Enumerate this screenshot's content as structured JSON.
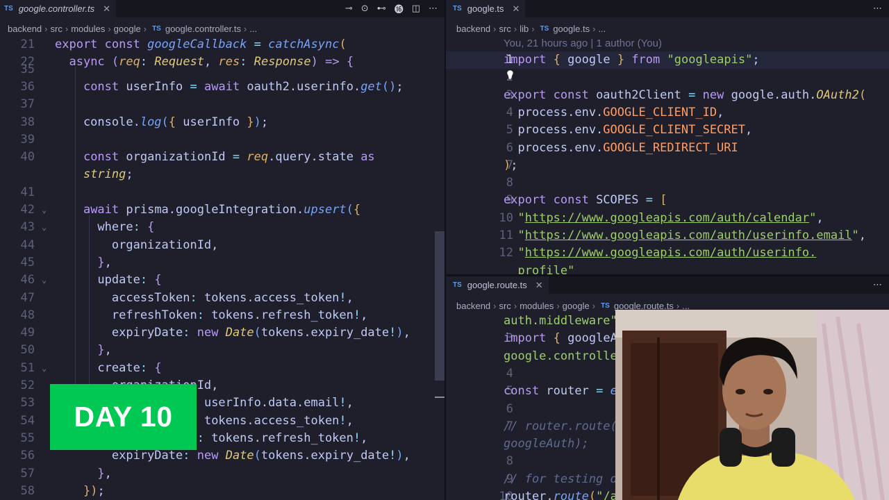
{
  "left_editor": {
    "tab": {
      "icon": "ts-file-icon",
      "label": "google.controller.ts"
    },
    "breadcrumbs": [
      "backend",
      "src",
      "modules",
      "google",
      "google.controller.ts",
      "..."
    ],
    "lines": [
      {
        "n": "21",
        "html": "<span class=\"k\">export const</span> <span class=\"f\">googleCallback</span> <span class=\"o\">=</span> <span class=\"f\">catchAsync</span><span class=\"b1\">(</span>"
      },
      {
        "n": "22",
        "html": "  <span class=\"k\">async</span> <span class=\"b2\">(</span><span class=\"p\">req</span><span class=\"o\">:</span> <span class=\"t\">Request</span>, <span class=\"p\">res</span><span class=\"o\">:</span> <span class=\"t\">Response</span><span class=\"b2\">)</span> <span class=\"k\">=&gt;</span> <span class=\"b2\">{</span>"
      },
      {
        "n": "35",
        "html": ""
      },
      {
        "n": "36",
        "html": "    <span class=\"k\">const</span> userInfo <span class=\"o\">=</span> <span class=\"k\">await</span> oauth2.userinfo.<span class=\"f\">get</span><span class=\"b3\">()</span>;"
      },
      {
        "n": "37",
        "html": ""
      },
      {
        "n": "38",
        "html": "    console.<span class=\"f\">log</span><span class=\"b3\">(</span><span class=\"b1\">{</span> userInfo <span class=\"b1\">}</span><span class=\"b3\">)</span>;"
      },
      {
        "n": "39",
        "html": ""
      },
      {
        "n": "40",
        "html": "    <span class=\"k\">const</span> organizationId <span class=\"o\">=</span> <span class=\"p\">req</span>.query.state <span class=\"k\">as</span>"
      },
      {
        "n": "",
        "html": "    <span class=\"t\">string</span>;"
      },
      {
        "n": "41",
        "html": ""
      },
      {
        "n": "42",
        "html": "    <span class=\"k\">await</span> prisma.googleIntegration.<span class=\"f\">upsert</span><span class=\"b3\">(</span><span class=\"b1\">{</span>"
      },
      {
        "n": "43",
        "html": "      where<span class=\"o\">:</span> <span class=\"b2\">{</span>"
      },
      {
        "n": "44",
        "html": "        organizationId,"
      },
      {
        "n": "45",
        "html": "      <span class=\"b2\">}</span>,"
      },
      {
        "n": "46",
        "html": "      update<span class=\"o\">:</span> <span class=\"b2\">{</span>"
      },
      {
        "n": "47",
        "html": "        accessToken<span class=\"o\">:</span> tokens.access_token<span class=\"o\">!</span>,"
      },
      {
        "n": "48",
        "html": "        refreshToken<span class=\"o\">:</span> tokens.refresh_token<span class=\"o\">!</span>,"
      },
      {
        "n": "49",
        "html": "        expiryDate<span class=\"o\">:</span> <span class=\"k\">new</span> <span class=\"t\">Date</span><span class=\"b3\">(</span>tokens.expiry_date<span class=\"o\">!</span><span class=\"b3\">)</span>,"
      },
      {
        "n": "50",
        "html": "      <span class=\"b2\">}</span>,"
      },
      {
        "n": "51",
        "html": "      create<span class=\"o\">:</span> <span class=\"b2\">{</span>"
      },
      {
        "n": "52",
        "html": "        organizationId,"
      },
      {
        "n": "53",
        "html": "        googleEmail<span class=\"o\">:</span> userInfo.data.email<span class=\"o\">!</span>,"
      },
      {
        "n": "54",
        "html": "        accessToken<span class=\"o\">:</span> tokens.access_token<span class=\"o\">!</span>,"
      },
      {
        "n": "55",
        "html": "        refreshToken<span class=\"o\">:</span> tokens.refresh_token<span class=\"o\">!</span>,"
      },
      {
        "n": "56",
        "html": "        expiryDate<span class=\"o\">:</span> <span class=\"k\">new</span> <span class=\"t\">Date</span><span class=\"b3\">(</span>tokens.expiry_date<span class=\"o\">!</span><span class=\"b3\">)</span>,"
      },
      {
        "n": "57",
        "html": "      <span class=\"b2\">}</span>,"
      },
      {
        "n": "58",
        "html": "    <span class=\"b1\">})</span>;"
      }
    ]
  },
  "top_right_editor": {
    "tab": {
      "icon": "ts-file-icon",
      "label": "google.ts"
    },
    "breadcrumbs": [
      "backend",
      "src",
      "lib",
      "google.ts",
      "..."
    ],
    "blame": "You, 21 hours ago | 1 author (You)",
    "lines": [
      {
        "n": "1",
        "html": "<span class=\"k\">import</span> <span class=\"b1\">{</span> google <span class=\"b1\">}</span> <span class=\"k\">from</span> <span class=\"s\">\"googleapis\"</span>;"
      },
      {
        "n": "2",
        "html": ""
      },
      {
        "n": "3",
        "html": "<span class=\"k\">export const</span> oauth2Client <span class=\"o\">=</span> <span class=\"k\">new</span> google.auth.<span class=\"t\">OAuth2</span><span class=\"b1\">(</span>"
      },
      {
        "n": "4",
        "html": "  process.env.<span class=\"env\">GOOGLE_CLIENT_ID</span>,"
      },
      {
        "n": "5",
        "html": "  process.env.<span class=\"env\">GOOGLE_CLIENT_SECRET</span>,"
      },
      {
        "n": "6",
        "html": "  process.env.<span class=\"env\">GOOGLE_REDIRECT_URI</span>"
      },
      {
        "n": "7",
        "html": "<span class=\"b1\">)</span>;"
      },
      {
        "n": "8",
        "html": ""
      },
      {
        "n": "9",
        "html": "<span class=\"k\">export const</span> SCOPES <span class=\"o\">=</span> <span class=\"b1\">[</span>"
      },
      {
        "n": "10",
        "html": "  <span class=\"s\">\"</span><span class=\"u\">https://www.googleapis.com/auth/calendar</span><span class=\"s\">\"</span>,"
      },
      {
        "n": "11",
        "html": "  <span class=\"s\">\"</span><span class=\"u\">https://www.googleapis.com/auth/userinfo.email</span><span class=\"s\">\"</span>,"
      },
      {
        "n": "12",
        "html": "  <span class=\"s\">\"</span><span class=\"u\">https://www.googleapis.com/auth/userinfo.</span>"
      },
      {
        "n": "",
        "html": "  <span class=\"s\">profile\"</span>"
      }
    ]
  },
  "bottom_right_editor": {
    "tab": {
      "icon": "ts-file-icon",
      "label": "google.route.ts"
    },
    "breadcrumbs": [
      "backend",
      "src",
      "modules",
      "google",
      "google.route.ts",
      "..."
    ],
    "lines": [
      {
        "n": "",
        "html": "<span class=\"s\">auth.middleware\"</span>;"
      },
      {
        "n": "3",
        "html": "<span class=\"k\">import</span> <span class=\"b1\">{</span> googleAuth, googleCallback <span class=\"b1\">}</span> <span class=\"k\">from</span> <span class=\"s\">\"./</span>"
      },
      {
        "n": "",
        "html": "<span class=\"s\">google.controller\"</span>;"
      },
      {
        "n": "4",
        "html": ""
      },
      {
        "n": "5",
        "html": "<span class=\"k\">const</span> router <span class=\"o\">=</span> <span class=\"f\">express</span>.<span class=\"f\">Router</span><span class=\"b1\">()</span>;"
      },
      {
        "n": "6",
        "html": ""
      },
      {
        "n": "7",
        "html": "<span class=\"c\">// router.route(\"/auth\").get(authenticate,</span>"
      },
      {
        "n": "",
        "html": "<span class=\"c\">googleAuth);</span>"
      },
      {
        "n": "8",
        "html": ""
      },
      {
        "n": "9",
        "html": "<span class=\"c\">// for testing only</span>"
      },
      {
        "n": "10",
        "html": "router.<span class=\"f\">route</span><span class=\"b1\">(</span><span class=\"s\">\"/auth\"</span><span class=\"b1\">)</span>"
      }
    ]
  },
  "overlay": {
    "badge": "DAY 10"
  },
  "colors": {
    "editor_bg": "#1e1f2b",
    "badge_green": "#00c853"
  }
}
